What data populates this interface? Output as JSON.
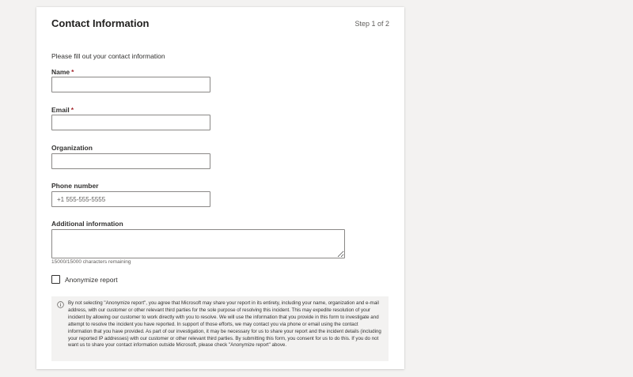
{
  "form": {
    "title": "Contact Information",
    "step": "Step 1 of 2",
    "intro": "Please fill out your contact information",
    "required_marker": "*",
    "fields": {
      "name": {
        "label": "Name",
        "value": "",
        "placeholder": ""
      },
      "email": {
        "label": "Email",
        "value": "",
        "placeholder": ""
      },
      "organization": {
        "label": "Organization",
        "value": "",
        "placeholder": ""
      },
      "phone": {
        "label": "Phone number",
        "value": "",
        "placeholder": "+1 555-555-5555"
      },
      "additional": {
        "label": "Additional information",
        "value": "",
        "counter": "15000/15000 characters remaining"
      }
    },
    "anonymize": {
      "label": "Anonymize report",
      "checked": false
    },
    "notice": {
      "icon": "info-icon",
      "text": "By not selecting \"Anonymize report\", you agree that Microsoft may share your report in its entirety, including your name, organization and e-mail address, with our customer or other relevant third parties for the sole purpose of resolving this incident. This may expedite resolution of your incident by allowing our customer to work directly with you to resolve. We will use the information that you provide in this form to investigate and attempt to resolve the incident you have reported. In support of those efforts, we may contact you via phone or email using the contact information that you have provided. As part of our investigation, it may be necessary for us to share your report and the incident details (including your reported IP addresses) with our customer or other relevant third parties. By submitting this form, you consent for us to do this. If you do not want us to share your contact information outside Microsoft, please check \"Anonymize report\" above."
    }
  },
  "colors": {
    "page_background": "#f3f2f1",
    "card_background": "#ffffff",
    "required": "#a4262c",
    "input_border": "#8a8886",
    "notice_background": "#f3f2f1"
  }
}
